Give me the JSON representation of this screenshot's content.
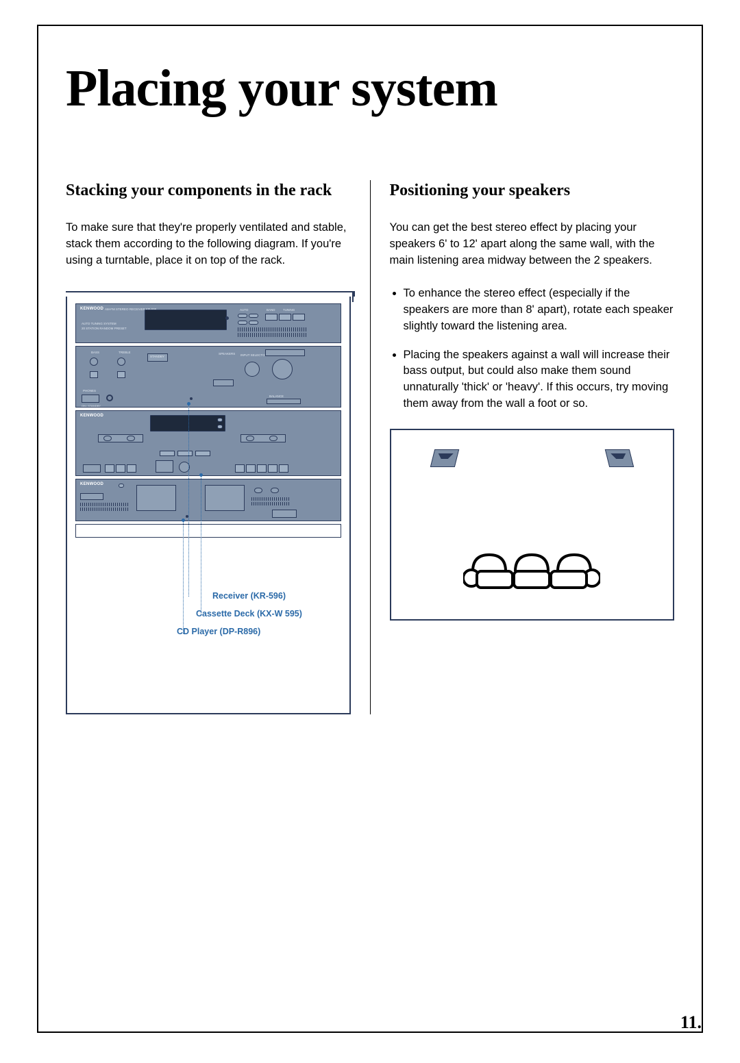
{
  "page": {
    "title": "Placing your system",
    "number": "11."
  },
  "left": {
    "heading": "Stacking your components in the rack",
    "para": "To make sure that they're properly ventilated and stable, stack them according to the following diagram. If you're using a turntable, place it on top of the rack.",
    "labels": {
      "receiver": "Receiver (KR-596)",
      "cassette": "Cassette Deck (KX-W 595)",
      "cd": "CD Player (DP-R896)"
    },
    "brand": "KENWOOD",
    "unit_text": {
      "receiver_model": "AM-FM STEREO RECEIVER KR-596",
      "system_line1": "AUTO TUNING SYSTEM",
      "system_line2": "20 STATION RANDOM PRESET",
      "bass": "BASS",
      "treble": "TREBLE",
      "standby": "STANDBY",
      "speakers": "SPEAKERS",
      "input_sel": "INPUT SELECTOR",
      "phones": "PHONES",
      "on_standby": "ON / STANDBY",
      "balance": "BALANCE",
      "auto": "AUTO",
      "band": "BAND",
      "tuning": "TUNING"
    }
  },
  "right": {
    "heading": "Positioning your speakers",
    "para": "You can get the best stereo effect by placing your speakers 6' to 12' apart along the same wall, with the main listening area midway between the 2 speakers.",
    "bullets": [
      "To enhance the stereo effect (especially if the speakers are more than 8' apart), rotate each speaker slightly toward the listening area.",
      "Placing the speakers against a wall will increase their bass output, but could also make them sound unnaturally 'thick' or 'heavy'. If this occurs, try moving them away from the wall a foot or so."
    ]
  }
}
